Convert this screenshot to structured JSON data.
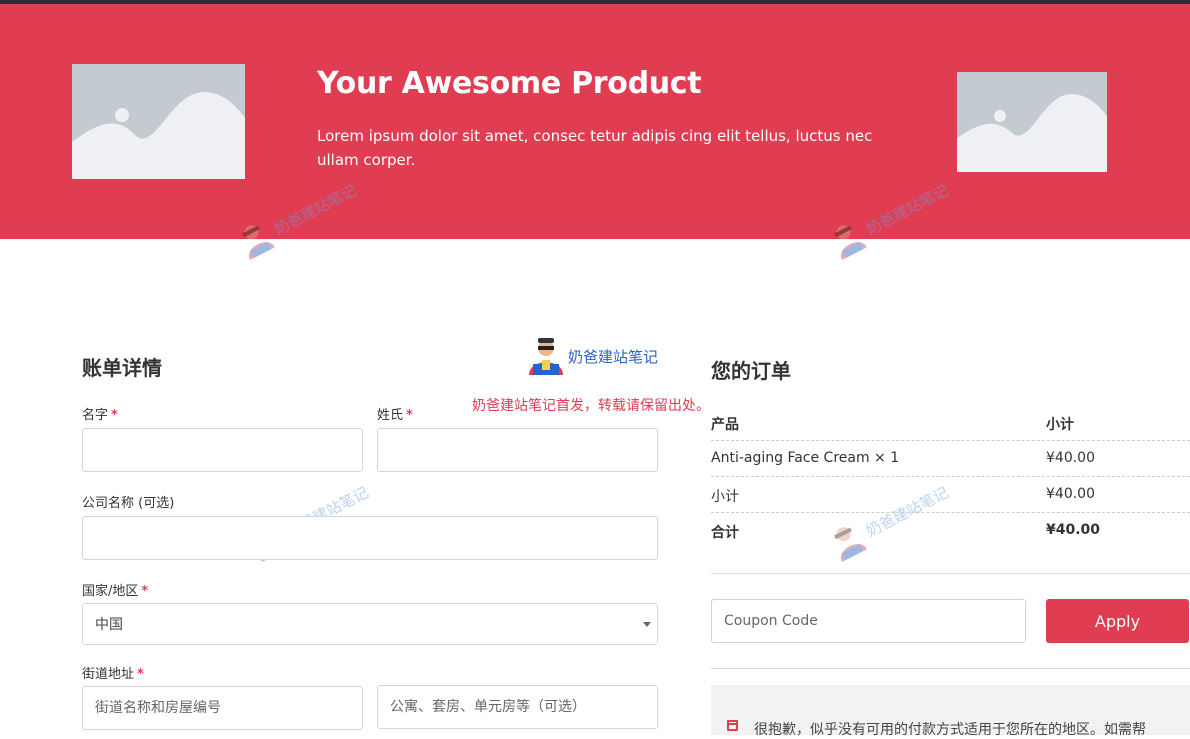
{
  "hero": {
    "title": "Your Awesome Product",
    "description": "Lorem ipsum dolor sit amet, consec tetur adipis cing elit tellus, luctus nec ullam corper."
  },
  "watermark": {
    "brand": "奶爸建站笔记",
    "notice": "奶爸建站笔记首发，转载请保留出处。"
  },
  "billing": {
    "title": "账单详情",
    "first_name_label": "名字",
    "last_name_label": "姓氏",
    "company_label": "公司名称 (可选)",
    "country_label": "国家/地区",
    "country_value": "中国",
    "street_label": "街道地址",
    "street_placeholder": "街道名称和房屋编号",
    "street2_placeholder": "公寓、套房、单元房等（可选）",
    "required_mark": "*"
  },
  "order": {
    "title": "您的订单",
    "col_product": "产品",
    "col_subtotal": "小计",
    "rows": [
      {
        "label": "Anti-aging Face Cream  × 1",
        "value": "¥40.00"
      },
      {
        "label": "小计",
        "value": "¥40.00"
      },
      {
        "label": "合计",
        "value": "¥40.00"
      }
    ],
    "coupon_placeholder": "Coupon Code",
    "apply_label": "Apply",
    "payment_notice": "很抱歉，似乎没有可用的付款方式适用于您所在的地区。如需帮"
  },
  "colors": {
    "brand": "#e03d52",
    "dark": "#2b2b33",
    "placeholder": "#c4cad2"
  },
  "icons": [
    "image-placeholder-icon",
    "watermark-avatar-icon",
    "select-caret-icon",
    "payment-notice-icon"
  ]
}
